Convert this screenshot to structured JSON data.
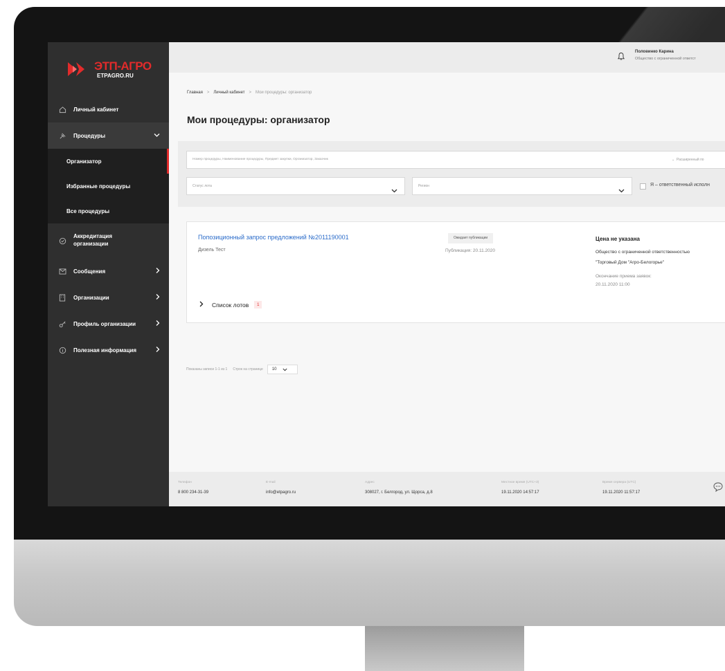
{
  "brand": {
    "name": "ЭТП-АГРО",
    "domain": "ETPAGRO.RU",
    "accent_color": "#e22b2b"
  },
  "sidebar": {
    "items": [
      {
        "label": "Личный кабинет",
        "icon": "home-icon"
      },
      {
        "label": "Процедуры",
        "icon": "gavel-icon",
        "expanded": true,
        "children": [
          {
            "label": "Организатор",
            "active": true
          },
          {
            "label": "Избранные процедуры"
          },
          {
            "label": "Все процедуры"
          }
        ]
      },
      {
        "label_line1": "Аккредитация",
        "label_line2": "организации",
        "icon": "check-circle-icon"
      },
      {
        "label": "Сообщения",
        "icon": "mail-icon"
      },
      {
        "label": "Организации",
        "icon": "building-icon"
      },
      {
        "label": "Профиль организации",
        "icon": "key-icon"
      },
      {
        "label": "Полезная информация",
        "icon": "info-icon"
      }
    ]
  },
  "topbar": {
    "user_name": "Половинко Карина",
    "user_org": "Общество с ограниченной ответст"
  },
  "breadcrumb": [
    "Главная",
    "Личный кабинет",
    "Мои процедуры: организатор"
  ],
  "page_title": "Мои процедуры: организатор",
  "filters": {
    "search_placeholder": "Номер процедуры, Наименование процедуры, Предмет закупки, Организатор, Заказчик",
    "advanced_label": "Расширенный по",
    "lot_status_placeholder": "Статус лота",
    "region_placeholder": "Регион",
    "responsible_label": "Я – ответственный исполн"
  },
  "procedure": {
    "title": "Попозиционный запрос предложений №2011190001",
    "subtitle": "Дизель Тест",
    "status": "Ожидает публикации",
    "publication": "Публикация: 20.11.2020",
    "price": "Цена не указана",
    "org_line1": "Общество с ограниченной ответственностью",
    "org_line2": "\"Торговый Дом \"Агро-Белогорье\"",
    "end_label": "Окончание приема заявок:",
    "end_date": "20.11.2020 11:00",
    "lots_label": "Список лотов",
    "lots_count": "1"
  },
  "pagination": {
    "shown": "Показаны записи 1-1 из 1",
    "rows_label": "Строк на странице",
    "rows_value": "10"
  },
  "footer": {
    "phone_label": "Телефон",
    "phone": "8 800 234-31-39",
    "email_label": "E-mail",
    "email": "info@etpagro.ru",
    "address_label": "Адрес",
    "address": "308027, г. Белгород, ул. Щорса, д.8",
    "local_time_label": "Местное время (UTC+3)",
    "local_time": "19.11.2020   14:57:17",
    "server_time_label": "Время сервера (UTC)",
    "server_time": "19.11.2020   11:57:17"
  }
}
